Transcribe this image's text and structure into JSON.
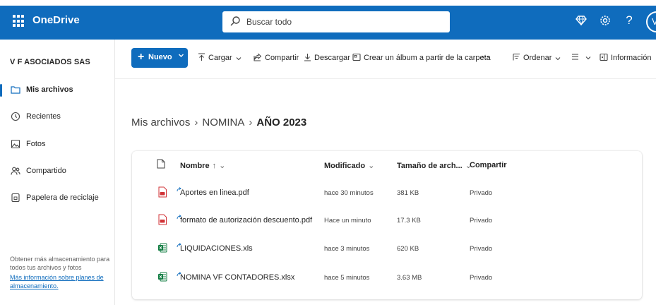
{
  "app": {
    "title": "OneDrive",
    "accent": "#0f6cbd",
    "search_placeholder": "Buscar todo",
    "avatar_initial": "V"
  },
  "sidebar": {
    "org_name": "V F ASOCIADOS SAS",
    "items": [
      {
        "label": "Mis archivos",
        "icon": "folder-icon",
        "active": true
      },
      {
        "label": "Recientes",
        "icon": "clock-icon",
        "active": false
      },
      {
        "label": "Fotos",
        "icon": "image-icon",
        "active": false
      },
      {
        "label": "Compartido",
        "icon": "people-icon",
        "active": false
      },
      {
        "label": "Papelera de reciclaje",
        "icon": "trash-icon",
        "active": false
      }
    ],
    "storage_text": "Obtener más almacenamiento para todos tus archivos y fotos",
    "storage_link": "Más información sobre planes de almacenamiento."
  },
  "toolbar": {
    "new_label": "Nuevo",
    "upload_label": "Cargar",
    "share_label": "Compartir",
    "download_label": "Descargar",
    "album_label": "Crear un álbum a partir de la carpeta",
    "more_label": "···",
    "sort_label": "Ordenar",
    "info_label": "Información"
  },
  "breadcrumb": {
    "items": [
      "Mis archivos",
      "NOMINA"
    ],
    "current": "AÑO 2023",
    "separator": "›"
  },
  "table": {
    "columns": {
      "name": "Nombre",
      "name_sort": "↑",
      "modified": "Modificado",
      "size": "Tamaño de arch...",
      "sharing": "Compartir"
    },
    "rows": [
      {
        "name": "Aportes en linea.pdf",
        "type": "pdf",
        "modified": "hace 30 minutos",
        "size": "381 KB",
        "sharing": "Privado"
      },
      {
        "name": "formato de autorización descuento.pdf",
        "type": "pdf",
        "modified": "Hace un minuto",
        "size": "17.3 KB",
        "sharing": "Privado"
      },
      {
        "name": "LIQUIDACIONES.xls",
        "type": "excel",
        "modified": "hace 3 minutos",
        "size": "620 KB",
        "sharing": "Privado"
      },
      {
        "name": "NOMINA VF CONTADORES.xlsx",
        "type": "excel",
        "modified": "hace 5 minutos",
        "size": "3.63 MB",
        "sharing": "Privado"
      }
    ]
  },
  "colors": {
    "pdf": "#d13438",
    "excel": "#107c41",
    "accent": "#0f6cbd"
  }
}
